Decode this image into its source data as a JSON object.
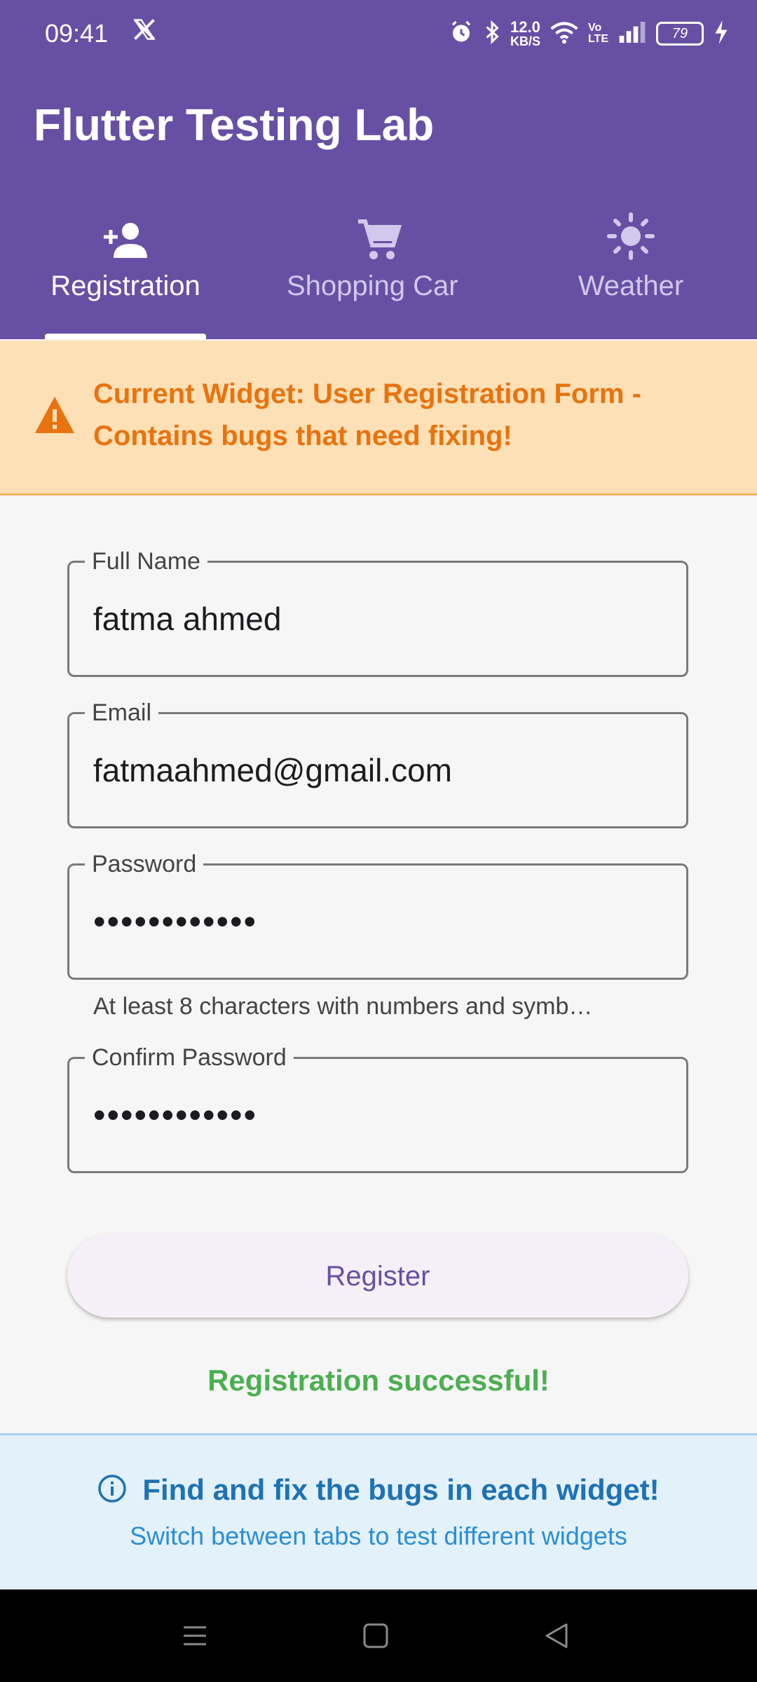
{
  "status_bar": {
    "time": "09:41",
    "app_icon": "x-logo-icon",
    "net_speed_value": "12.0",
    "net_speed_unit": "KB/S",
    "volte_top": "Vo",
    "volte_bottom": "LTE",
    "battery": "79",
    "icons": [
      "alarm-icon",
      "bluetooth-icon",
      "wifi-icon",
      "signal-icon",
      "battery-icon",
      "charging-icon"
    ]
  },
  "app_bar": {
    "title": "Flutter Testing Lab",
    "background_color": "#6750a4"
  },
  "tabs": [
    {
      "label": "Registration",
      "icon": "person-add-icon",
      "active": true
    },
    {
      "label": "Shopping Car",
      "icon": "shopping-cart-icon",
      "active": false
    },
    {
      "label": "Weather",
      "icon": "sun-icon",
      "active": false
    }
  ],
  "warning": {
    "icon": "warning-icon",
    "text": "Current Widget: User Registration Form - Contains bugs that need fixing!",
    "color": "#e8730f",
    "background": "#fde0b5"
  },
  "form": {
    "full_name": {
      "label": "Full Name",
      "value": "fatma ahmed"
    },
    "email": {
      "label": "Email",
      "value": "fatmaahmed@gmail.com"
    },
    "password": {
      "label": "Password",
      "value": "••••••••••••",
      "helper": "At least 8 characters with numbers and symb…"
    },
    "confirm_password": {
      "label": "Confirm Password",
      "value": "••••••••••••"
    },
    "register_label": "Register",
    "success_message": "Registration successful!",
    "success_color": "#4caf50"
  },
  "info_panel": {
    "icon": "info-icon",
    "title": "Find and fix the bugs in each widget!",
    "subtitle": "Switch between tabs to test different widgets",
    "color": "#1e72b5"
  },
  "nav_bar": {
    "buttons": [
      "menu-icon",
      "home-square-icon",
      "back-triangle-icon"
    ]
  }
}
